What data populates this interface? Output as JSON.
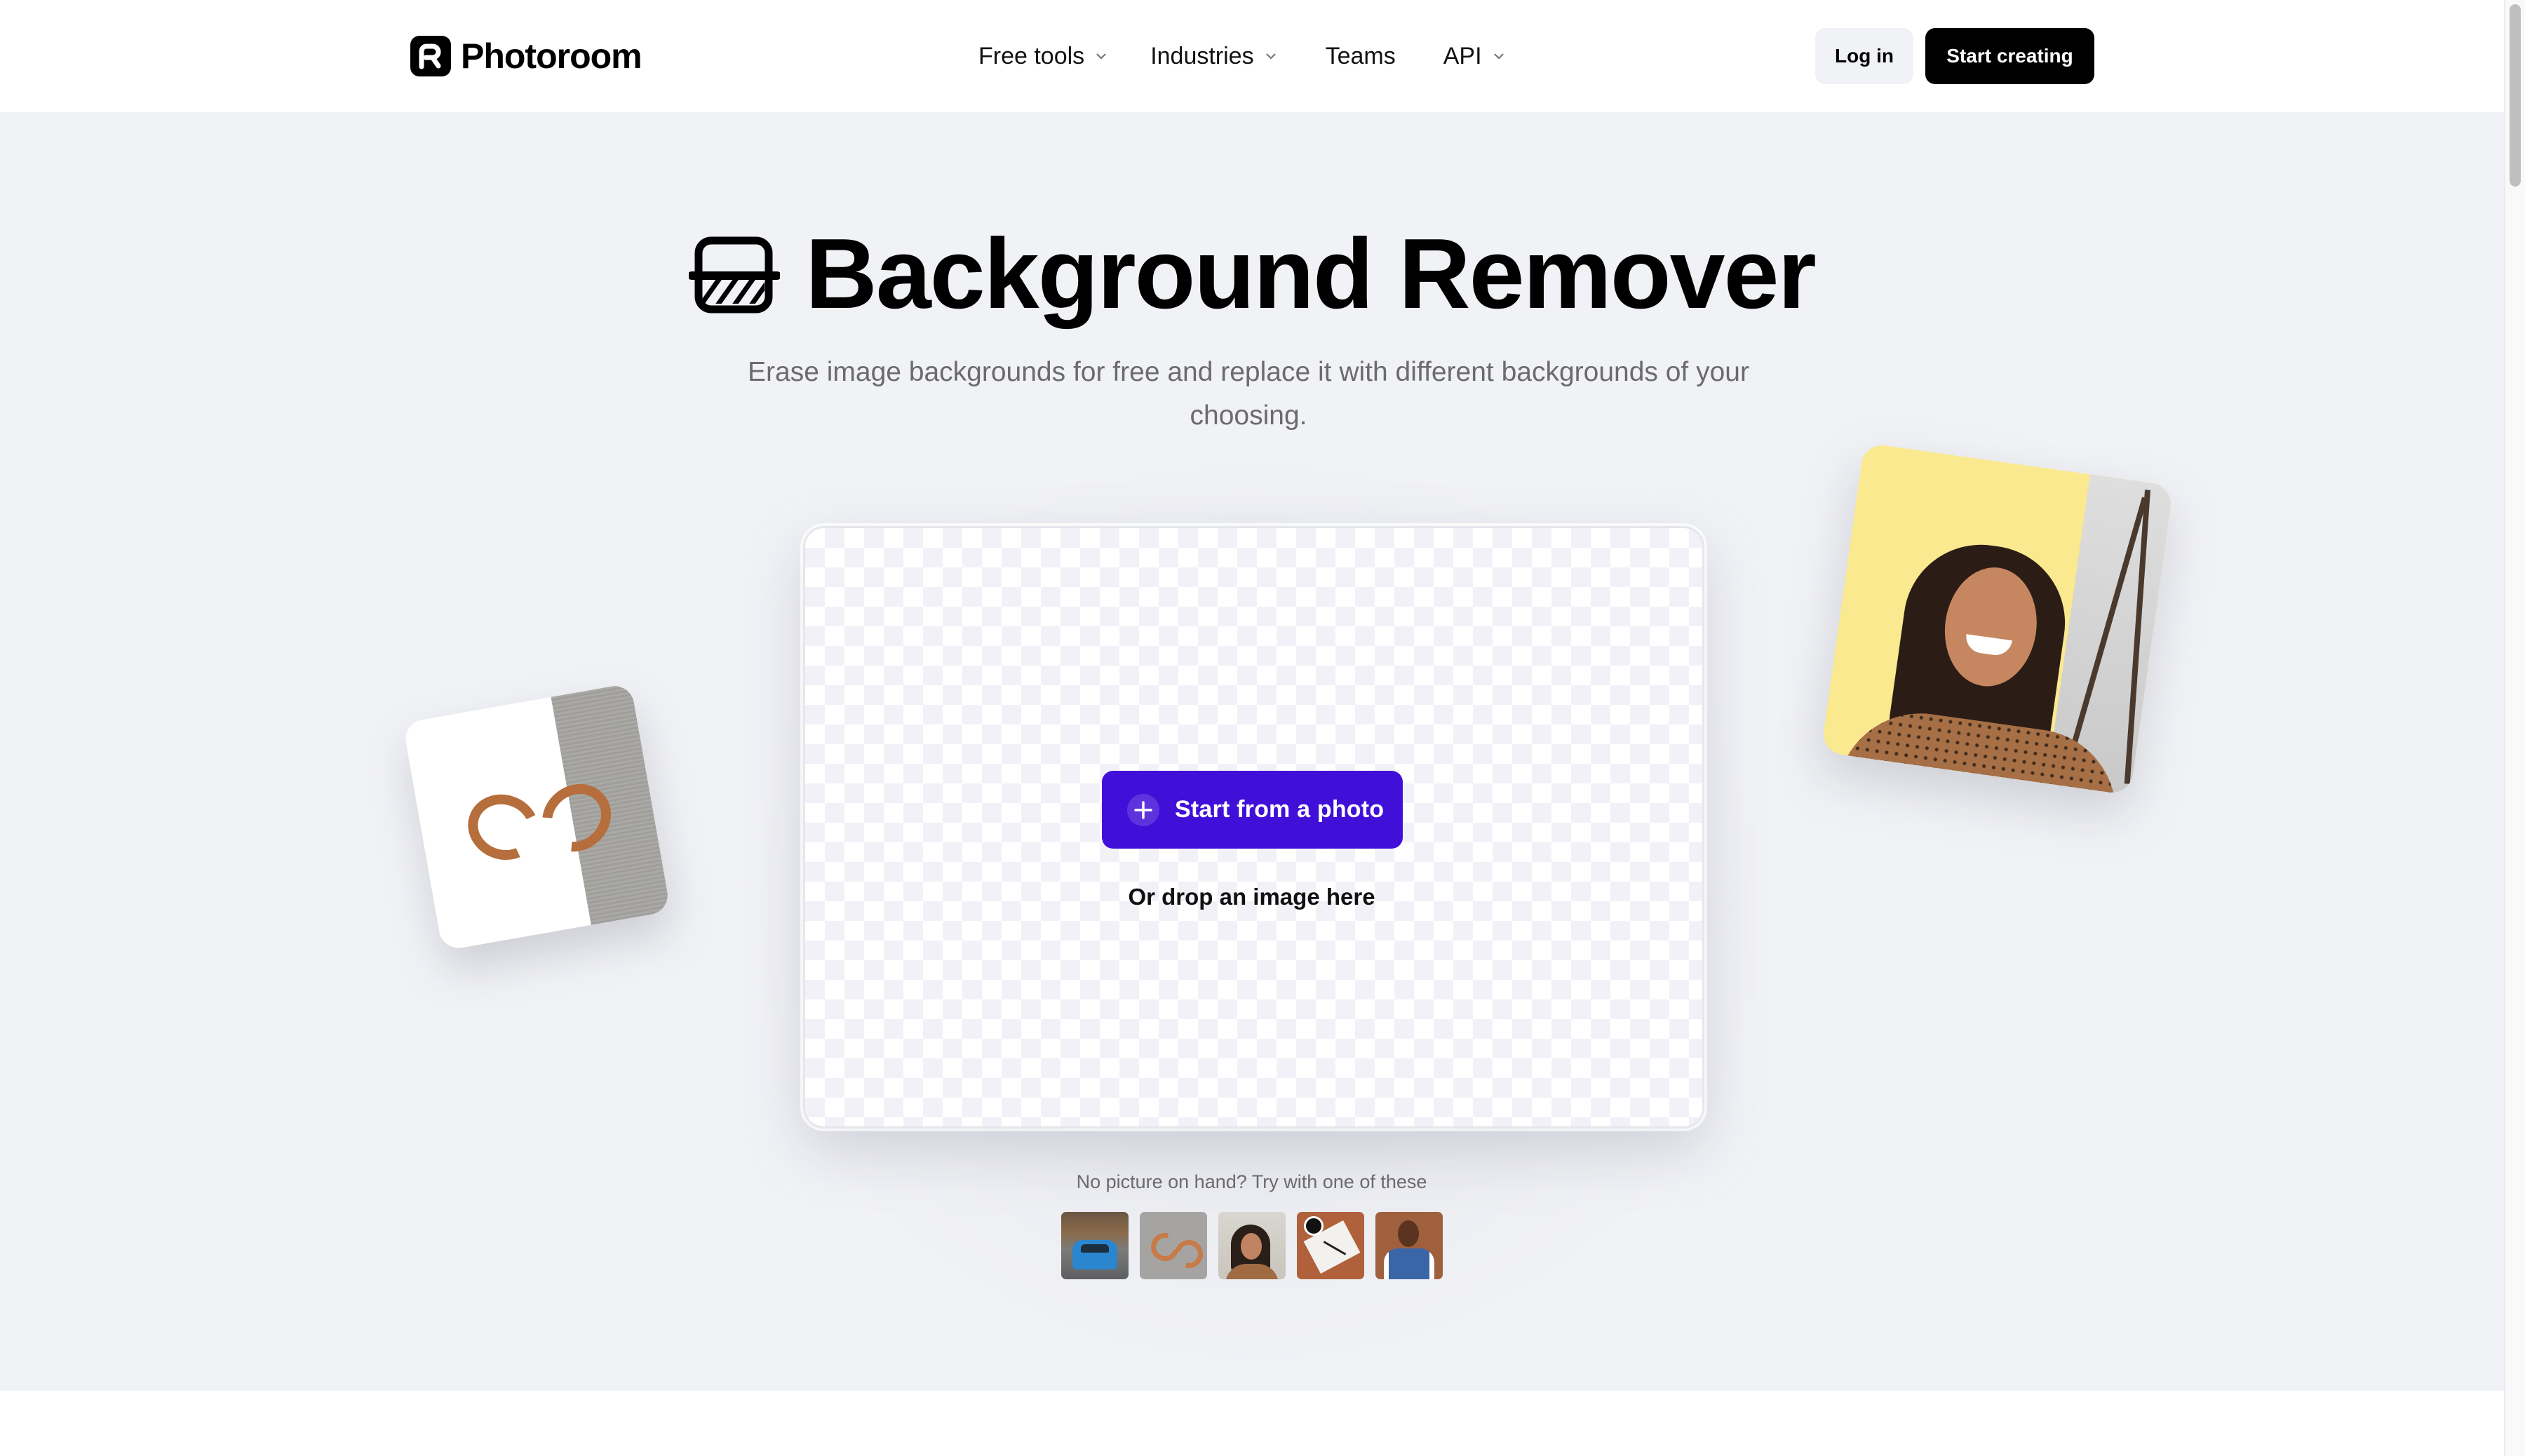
{
  "header": {
    "brand": "Photoroom",
    "nav": [
      {
        "label": "Free tools",
        "has_dropdown": true
      },
      {
        "label": "Industries",
        "has_dropdown": true
      },
      {
        "label": "Teams",
        "has_dropdown": false
      },
      {
        "label": "API",
        "has_dropdown": true
      }
    ],
    "login_label": "Log in",
    "cta_label": "Start creating"
  },
  "hero": {
    "icon": "background-remover-icon",
    "title": "Background Remover",
    "subtitle": "Erase image backgrounds for free and replace it with different backgrounds of your choosing."
  },
  "upload": {
    "button_label": "Start from a photo",
    "button_icon": "plus-icon",
    "drop_hint": "Or drop an image here",
    "accent_color": "#4110d8"
  },
  "samples": {
    "label": "No picture on hand? Try with one of these",
    "items": [
      {
        "name": "blue-car"
      },
      {
        "name": "copper-earrings"
      },
      {
        "name": "smiling-woman-palms"
      },
      {
        "name": "notebook-coffee-desk"
      },
      {
        "name": "smiling-person-patterned-shirt"
      }
    ]
  },
  "decor": {
    "left_card": "earrings-before-after",
    "right_card": "woman-yellow-background-before-after"
  }
}
